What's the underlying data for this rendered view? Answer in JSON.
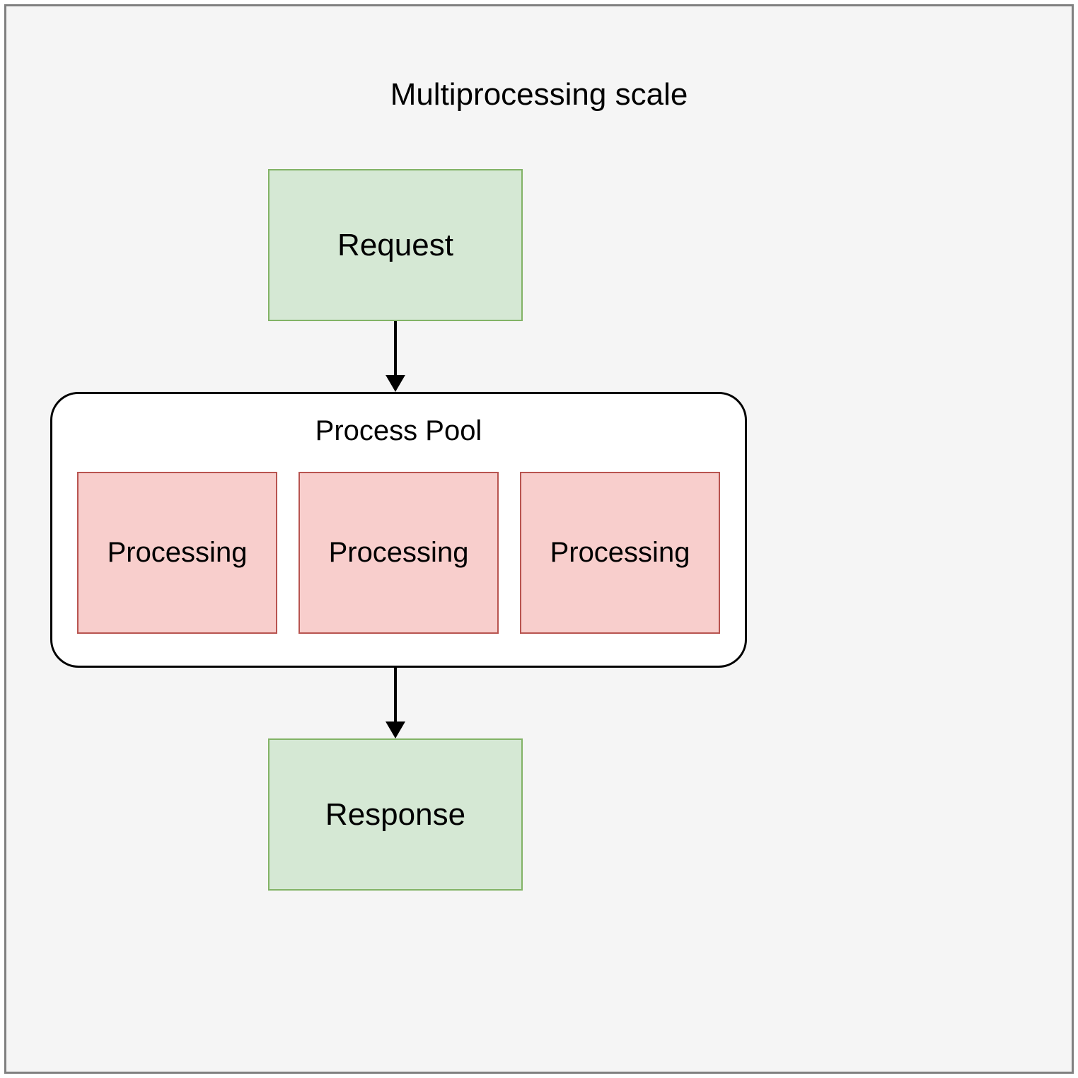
{
  "title": "Multiprocessing scale",
  "request": {
    "label": "Request"
  },
  "pool": {
    "title": "Process Pool",
    "items": [
      {
        "label": "Processing"
      },
      {
        "label": "Processing"
      },
      {
        "label": "Processing"
      }
    ]
  },
  "response": {
    "label": "Response"
  },
  "colors": {
    "greenFill": "#d5e8d4",
    "greenStroke": "#82b366",
    "pinkFill": "#f8cecc",
    "pinkStroke": "#b85450",
    "canvasBg": "#f5f5f5",
    "canvasBorder": "#808080"
  }
}
